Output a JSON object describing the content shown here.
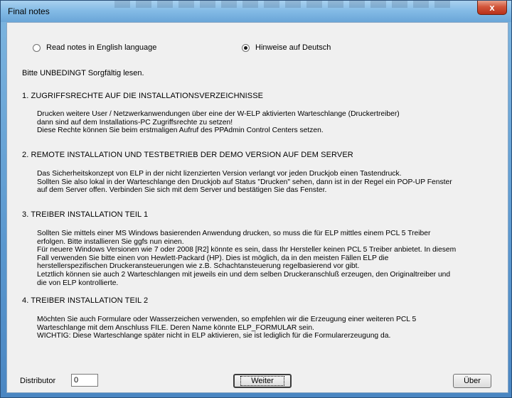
{
  "window": {
    "title": "Final notes",
    "close_label": "x"
  },
  "language": {
    "english_label": "Read notes in English language",
    "german_label": "Hinweise auf Deutsch",
    "selected": "german"
  },
  "intro": "Bitte UNBEDINGT Sorgfältig lesen.",
  "sections": [
    {
      "heading": "1.  ZUGRIFFSRECHTE AUF DIE INSTALLATIONSVERZEICHNISSE",
      "lines": [
        "Drucken weitere User / Netzwerkanwendungen über eine der W-ELP aktivierten Warteschlange (Druckertreiber)",
        "dann sind auf dem Installations-PC Zugriffsrechte zu setzen!",
        "Diese Rechte können Sie beim erstmaligen Aufruf des PPAdmin Control Centers setzen."
      ]
    },
    {
      "heading": "2.  REMOTE INSTALLATION UND TESTBETRIEB DER DEMO VERSION AUF DEM SERVER",
      "lines": [
        "Das Sicherheitskonzept von ELP in der nicht lizenzierten Version verlangt vor jeden Druckjob einen Tastendruck.",
        "Sollten Sie also lokal in der Warteschlange den Druckjob auf Status \"Drucken\" sehen, dann ist in der Regel ein POP-UP Fenster",
        "auf dem Server offen. Verbinden Sie sich mit dem Server und bestätigen Sie das Fenster."
      ]
    },
    {
      "heading": "3.  TREIBER INSTALLATION TEIL 1",
      "lines": [
        "Sollten Sie mittels einer MS Windows basierenden Anwendung drucken, so muss die für ELP mittles einem PCL 5 Treiber",
        "erfolgen. Bitte installieren Sie ggfs nun einen.",
        "Für neuere Windows Versionen wie 7 oder 2008 [R2] könnte es sein, dass Ihr Hersteller keinen PCL 5 Treiber anbietet. In diesem",
        "Fall verwenden Sie bitte einen von Hewlett-Packard (HP). Dies ist möglich, da in den meisten Fällen ELP die",
        "herstellerspezifischen Druckeransteuerungen wie z.B. Schachtansteuerung regelbasierend vor gibt.",
        "Letztlich können sie auch 2 Warteschlangen mit jeweils ein und dem selben Druckeranschluß erzeugen, den Originaltreiber und",
        "die von ELP kontrollierte."
      ]
    },
    {
      "heading": "4.  TREIBER INSTALLATION TEIL 2",
      "lines": [
        "Möchten Sie auch Formulare oder Wasserzeichen verwenden, so empfehlen wir die Erzeugung einer weiteren PCL 5",
        "Warteschlange mit dem Anschluss FILE. Deren Name könnte ELP_FORMULAR sein.",
        "WICHTIG: Diese Warteschlange später nicht in ELP aktivieren, sie ist lediglich für die Formularerzeugung da."
      ]
    }
  ],
  "footer": {
    "distributor_label": "Distributor",
    "distributor_value": "0",
    "next_label": "Weiter",
    "about_label": "Über"
  }
}
